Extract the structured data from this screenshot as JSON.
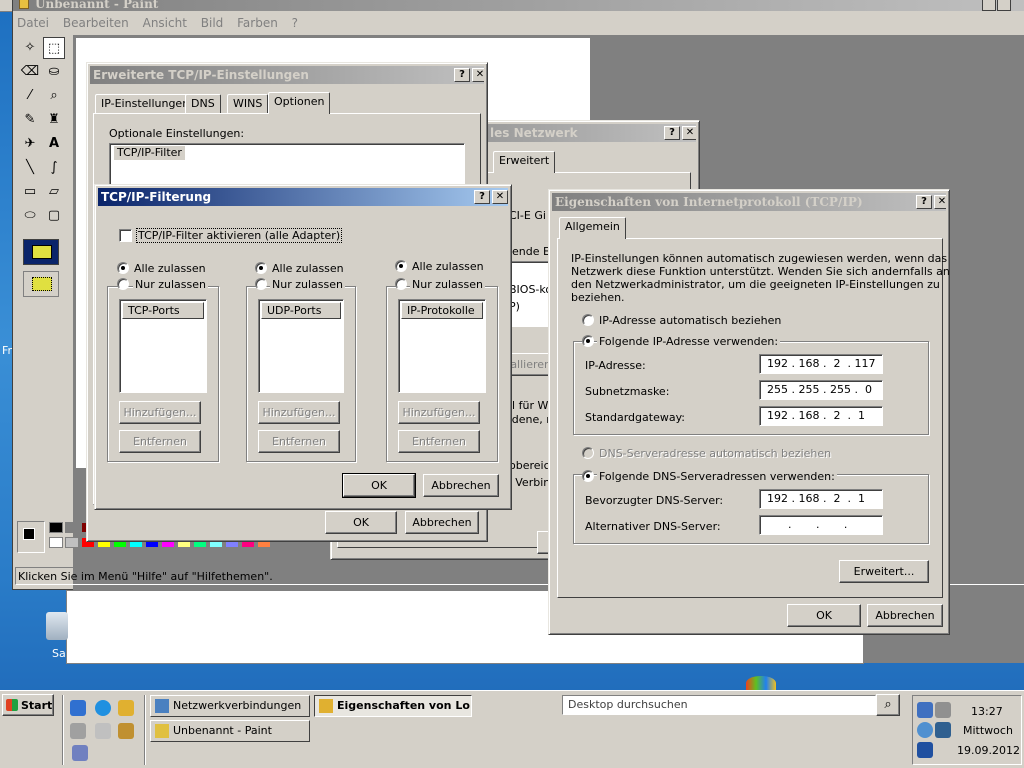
{
  "paint": {
    "title": "Unbenannt - Paint",
    "menu": [
      "Datei",
      "Bearbeiten",
      "Ansicht",
      "Bild",
      "Farben",
      "?"
    ],
    "status": "Klicken Sie im Menü \"Hilfe\" auf \"Hilfethemen\"."
  },
  "netwin": {
    "title": "les Netzwerk",
    "tab": "Erweitert",
    "frag1": "CI-E Gi",
    "frag2": "gende E",
    "frag3": "BIOS-ko",
    "frag4": "P)",
    "frag5": "tallieren",
    "frag6": "ll für WA",
    "frag7": "edene, r",
    "frag8": "obereic",
    "frag9": "e Verbin"
  },
  "erweitert": {
    "title": "Erweiterte TCP/IP-Einstellungen",
    "tabs": [
      "IP-Einstellungen",
      "DNS",
      "WINS",
      "Optionen"
    ],
    "label": "Optionale Einstellungen:",
    "item": "TCP/IP-Filter",
    "ok": "OK",
    "cancel": "Abbrechen"
  },
  "filter": {
    "title": "TCP/IP-Filterung",
    "check": "TCP/IP-Filter aktivieren (alle Adapter)",
    "allow_all": "Alle zulassen",
    "only_allow": "Nur zulassen",
    "col_tcp": "TCP-Ports",
    "col_udp": "UDP-Ports",
    "col_ip": "IP-Protokolle",
    "add": "Hinzufügen...",
    "remove": "Entfernen",
    "ok": "OK",
    "cancel": "Abbrechen"
  },
  "props": {
    "title": "Eigenschaften von Internetprotokoll (TCP/IP)",
    "tab": "Allgemein",
    "intro": [
      "IP-Einstellungen können automatisch zugewiesen werden, wenn das",
      "Netzwerk diese Funktion unterstützt. Wenden Sie sich andernfalls an",
      "den Netzwerkadministrator, um die geeigneten IP-Einstellungen zu",
      "beziehen."
    ],
    "auto_ip": "IP-Adresse automatisch beziehen",
    "use_ip": "Folgende IP-Adresse verwenden:",
    "ip_label": "IP-Adresse:",
    "ip_value": "192 . 168 .  2  . 117",
    "mask_label": "Subnetzmaske:",
    "mask_value": "255 . 255 . 255 .  0",
    "gw_label": "Standardgateway:",
    "gw_value": "192 . 168 .  2  .  1",
    "auto_dns": "DNS-Serveradresse automatisch beziehen",
    "use_dns": "Folgende DNS-Serveradressen verwenden:",
    "dns1_label": "Bevorzugter DNS-Server:",
    "dns1_value": "192 . 168 .  2  .  1",
    "dns2_label": "Alternativer DNS-Server:",
    "dns2_value": "      .       .       .",
    "advanced": "Erweitert...",
    "ok": "OK",
    "cancel": "Abbrechen"
  },
  "desktop": {
    "frag_left": "Fr",
    "frag_icon": "Sa"
  },
  "taskbar": {
    "start": "Start",
    "tasks": [
      "Netzwerkverbindungen",
      "Eigenschaften von Lo...",
      "Unbenannt - Paint"
    ],
    "search_placeholder": "Desktop durchsuchen",
    "time": "13:27",
    "day": "Mittwoch",
    "date": "19.09.2012"
  },
  "colors": {
    "titlebar_active": "#0a246a",
    "titlebar_inactive": "#808080",
    "face": "#d4d0c8"
  }
}
